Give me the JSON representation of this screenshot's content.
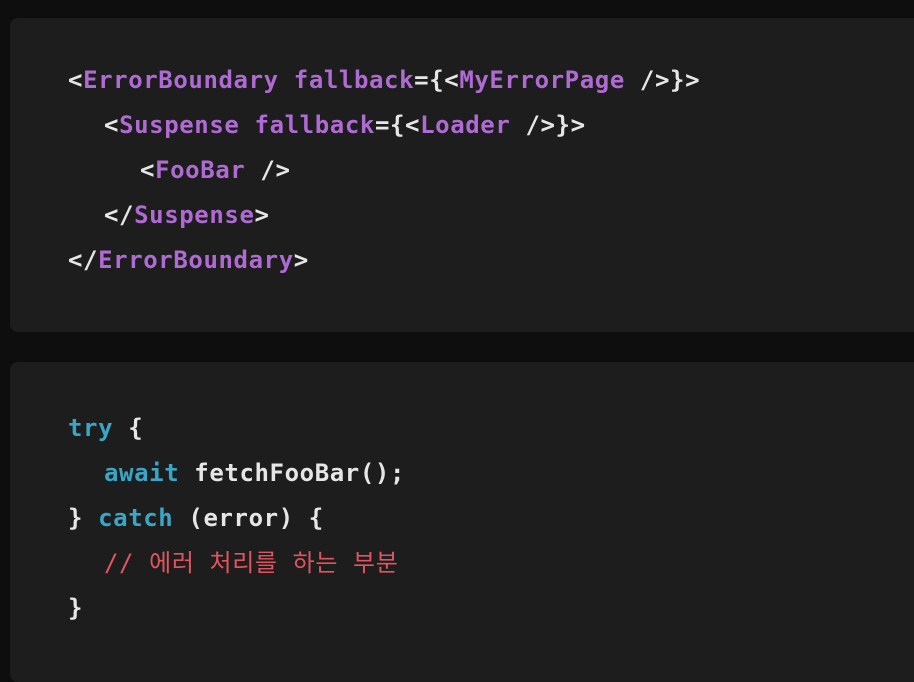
{
  "colors": {
    "background": "#0e0e0e",
    "panel": "#1d1d1e",
    "tag": "#b06ad3",
    "keyword": "#3aa6c6",
    "text": "#e6e6e6",
    "comment": "#e05560"
  },
  "code_blocks": [
    {
      "name": "jsx-block",
      "lines": [
        {
          "indent": 0,
          "tokens": [
            {
              "k": "punct",
              "t": "<"
            },
            {
              "k": "tag",
              "t": "ErrorBoundary"
            },
            {
              "k": "plain",
              "t": " "
            },
            {
              "k": "attr",
              "t": "fallback"
            },
            {
              "k": "punct",
              "t": "={<"
            },
            {
              "k": "tag",
              "t": "MyErrorPage"
            },
            {
              "k": "punct",
              "t": " />}>"
            }
          ]
        },
        {
          "indent": 1,
          "tokens": [
            {
              "k": "punct",
              "t": "<"
            },
            {
              "k": "tag",
              "t": "Suspense"
            },
            {
              "k": "plain",
              "t": " "
            },
            {
              "k": "attr",
              "t": "fallback"
            },
            {
              "k": "punct",
              "t": "={<"
            },
            {
              "k": "tag",
              "t": "Loader"
            },
            {
              "k": "punct",
              "t": " />}>"
            }
          ]
        },
        {
          "indent": 2,
          "tokens": [
            {
              "k": "punct",
              "t": "<"
            },
            {
              "k": "tag",
              "t": "FooBar"
            },
            {
              "k": "punct",
              "t": " />"
            }
          ]
        },
        {
          "indent": 1,
          "tokens": [
            {
              "k": "punct",
              "t": "</"
            },
            {
              "k": "tag",
              "t": "Suspense"
            },
            {
              "k": "punct",
              "t": ">"
            }
          ]
        },
        {
          "indent": 0,
          "tokens": [
            {
              "k": "punct",
              "t": "</"
            },
            {
              "k": "tag",
              "t": "ErrorBoundary"
            },
            {
              "k": "punct",
              "t": ">"
            }
          ]
        }
      ]
    },
    {
      "name": "try-catch-block",
      "lines": [
        {
          "indent": 0,
          "tokens": [
            {
              "k": "kw",
              "t": "try"
            },
            {
              "k": "plain",
              "t": " {"
            }
          ]
        },
        {
          "indent": 1,
          "tokens": [
            {
              "k": "kw",
              "t": "await"
            },
            {
              "k": "plain",
              "t": " fetchFooBar();"
            }
          ]
        },
        {
          "indent": 0,
          "tokens": [
            {
              "k": "plain",
              "t": "} "
            },
            {
              "k": "kw",
              "t": "catch"
            },
            {
              "k": "plain",
              "t": " (error) {"
            }
          ]
        },
        {
          "indent": 1,
          "tokens": [
            {
              "k": "comment",
              "t": "// 에러 처리를 하는 부분"
            }
          ]
        },
        {
          "indent": 0,
          "tokens": [
            {
              "k": "plain",
              "t": "}"
            }
          ]
        }
      ]
    }
  ]
}
